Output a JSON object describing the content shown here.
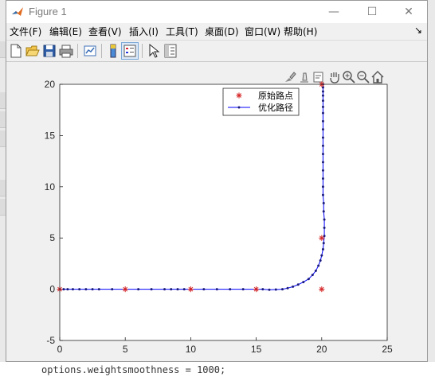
{
  "window": {
    "title": "Figure 1",
    "min_glyph": "—",
    "max_glyph": "☐",
    "close_glyph": "✕"
  },
  "menu": {
    "items": [
      "文件(F)",
      "编辑(E)",
      "查看(V)",
      "插入(I)",
      "工具(T)",
      "桌面(D)",
      "窗口(W)",
      "帮助(H)"
    ],
    "overflow_glyph": "↘"
  },
  "toolbar": {
    "icons": [
      "new-figure-icon",
      "open-icon",
      "save-icon",
      "print-icon",
      "link-plot-icon",
      "colorbar-icon",
      "legend-icon",
      "pointer-icon",
      "property-inspector-icon"
    ]
  },
  "axes_toolbar": {
    "icons": [
      "brush-icon",
      "data-tips-icon",
      "rotate-icon",
      "pan-hand-icon",
      "zoom-in-icon",
      "zoom-out-icon",
      "home-icon"
    ]
  },
  "background": {
    "code_line": "options.weightsmoothness = 1000;"
  },
  "chart_data": {
    "type": "line",
    "xlim": [
      0,
      25
    ],
    "ylim": [
      -5,
      20
    ],
    "x_ticks": [
      0,
      5,
      10,
      15,
      20,
      25
    ],
    "y_ticks": [
      -5,
      0,
      5,
      10,
      15,
      20
    ],
    "grid": false,
    "legend_position": "top-right",
    "series": [
      {
        "name": "原始路点",
        "style": "markers",
        "marker": "*",
        "color": "#d62728",
        "x": [
          0,
          5,
          10,
          15,
          20,
          20,
          20
        ],
        "y": [
          0,
          0,
          0,
          0,
          0,
          5,
          20
        ]
      },
      {
        "name": "优化路径",
        "style": "line-dots",
        "color": "#0000ff",
        "marker_color": "#1a1a7a",
        "x": [
          0,
          0.3,
          0.6,
          1.0,
          1.5,
          2.0,
          2.5,
          3.0,
          4.0,
          5.0,
          6.0,
          7.0,
          8.0,
          8.5,
          9.0,
          9.5,
          10.0,
          11.0,
          12.0,
          13.0,
          14.0,
          15.0,
          15.5,
          16.0,
          16.5,
          17.0,
          17.4,
          17.8,
          18.2,
          18.6,
          19.0,
          19.3,
          19.55,
          19.75,
          19.9,
          20.0,
          20.1,
          20.15,
          20.2,
          20.2,
          20.2,
          20.15,
          20.15,
          20.1,
          20.1,
          20.1,
          20.1,
          20.1,
          20.1,
          20.1,
          20.1,
          20.1,
          20.1,
          20.1,
          20.1,
          20.1,
          20.1,
          20.1,
          20.1,
          20.1
        ],
        "y": [
          0,
          0,
          0,
          0,
          0,
          0,
          0,
          0,
          0,
          0,
          0,
          0,
          0,
          0,
          0,
          0,
          0,
          0,
          0,
          0,
          0,
          0,
          0,
          -0.05,
          -0.03,
          0,
          0.1,
          0.25,
          0.45,
          0.7,
          1.0,
          1.4,
          1.8,
          2.3,
          2.8,
          3.3,
          3.9,
          4.5,
          5.2,
          6.0,
          6.8,
          7.6,
          8.4,
          9.2,
          10.0,
          10.8,
          11.6,
          12.4,
          13.2,
          14.0,
          14.8,
          15.6,
          16.4,
          17.2,
          17.8,
          18.4,
          18.9,
          19.3,
          19.7,
          20.0
        ]
      }
    ]
  }
}
